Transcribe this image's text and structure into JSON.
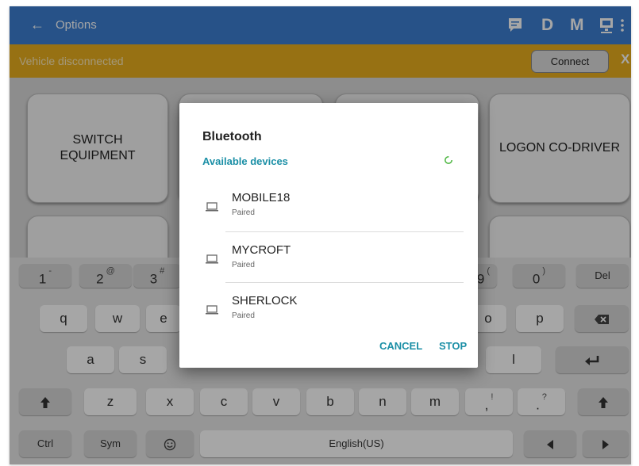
{
  "appbar": {
    "back_icon": "arrow-left-icon",
    "title": "Options",
    "message_icon": "chat-icon",
    "d_label": "D",
    "m_label": "M",
    "pc_icon": "computer-icon",
    "more_icon": "more-vert-icon",
    "background": "#3d7ed1"
  },
  "banner": {
    "status_text": "Vehicle disconnected",
    "connect_label": "Connect",
    "close_label": "X",
    "background": "#e8ae1e"
  },
  "tiles": {
    "switch_equipment": "SWITCH EQUIPMENT",
    "logon_co_driver": "LOGON CO-DRIVER"
  },
  "dialog": {
    "title": "Bluetooth",
    "subtitle": "Available devices",
    "devices": [
      {
        "name": "MOBILE18",
        "status": "Paired"
      },
      {
        "name": "MYCROFT",
        "status": "Paired"
      },
      {
        "name": "SHERLOCK",
        "status": "Paired"
      }
    ],
    "cancel_label": "CANCEL",
    "stop_label": "STOP",
    "accent": "#1b8fa6"
  },
  "keyboard": {
    "row1": [
      {
        "main": "1",
        "alt": "-"
      },
      {
        "main": "2",
        "alt": "@"
      },
      {
        "main": "3",
        "alt": "#"
      },
      {
        "main": "9",
        "alt": "("
      },
      {
        "main": "0",
        "alt": ")"
      },
      {
        "main": "Del",
        "alt": ""
      }
    ],
    "row2": [
      "q",
      "w",
      "e",
      "o",
      "p"
    ],
    "row2_backspace_icon": "backspace-icon",
    "row3": [
      "a",
      "s",
      "l"
    ],
    "row3_enter_icon": "enter-icon",
    "row4": [
      "z",
      "x",
      "c",
      "v",
      "b",
      "n",
      "m"
    ],
    "row4_punct": [
      {
        "main": ",",
        "alt": "!"
      },
      {
        "main": ".",
        "alt": "?"
      }
    ],
    "shift_icon": "shift-up-icon",
    "row5": {
      "ctrl": "Ctrl",
      "sym": "Sym",
      "space": "English(US)"
    },
    "emoji_icon": "smiley-icon",
    "left_icon": "arrow-left-icon",
    "right_icon": "arrow-right-icon"
  }
}
